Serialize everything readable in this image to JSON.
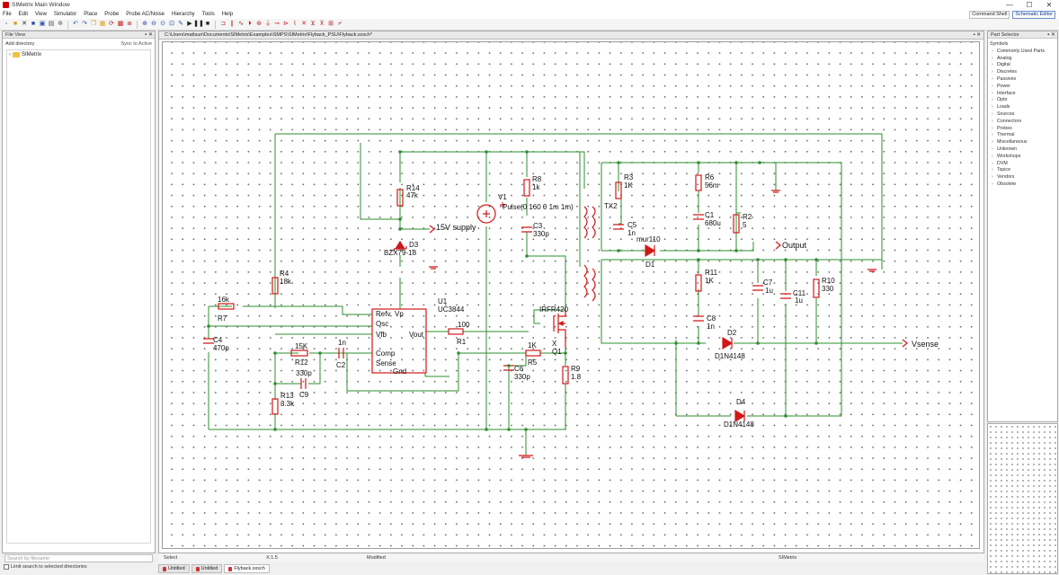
{
  "window": {
    "title": "SIMetrix Main Window",
    "controls": [
      "—",
      "☐",
      "✕"
    ]
  },
  "menu": {
    "items": [
      "File",
      "Edit",
      "View",
      "Simulator",
      "Place",
      "Probe",
      "Probe AC/Noise",
      "Hierarchy",
      "Tools",
      "Help"
    ],
    "right_buttons": [
      "Command Shell",
      "Schematic Editor"
    ]
  },
  "toolbar": {
    "buttons": [
      "new-icon",
      "open-icon",
      "cut-icon",
      "save-icon",
      "save-all-icon",
      "print-icon",
      "settings-icon",
      "undo-icon",
      "redo-icon",
      "copy-icon",
      "paste-icon",
      "rotate-icon",
      "delete-icon",
      "net-icon",
      "zoom-in-icon",
      "zoom-out-icon",
      "zoom-full-icon",
      "zoom-box-icon",
      "pencil-icon",
      "run-icon",
      "pause-icon",
      "abort-icon",
      "resistor-icon",
      "capacitor-icon",
      "inductor-icon",
      "diode-icon",
      "source-icon",
      "ground-icon",
      "probe-icon",
      "terminal-icon",
      "wire-icon",
      "cross-probe-icon",
      "check-icon",
      "edit-icon",
      "tools-icon",
      "text-icon"
    ]
  },
  "file_view": {
    "title": "File View",
    "add_directory": "Add directory",
    "sync": "Sync to Active",
    "tree_item": "SIMetrix",
    "search_placeholder": "Search by filename",
    "limit_search": "Limit search to selected directories"
  },
  "schematic": {
    "path": "C:\\Users\\mattsun\\Documents\\SIMetrix\\Examples\\SMPS\\SIMetrix\\Flyback_PSU\\Flyback.sxsch*",
    "components": {
      "R14": "R14",
      "R14v": "47k",
      "V1": "V1",
      "V1v": "Pulse(0 160 0 1m 1m)",
      "R8": "R8",
      "R8v": "1k",
      "C3": "C3",
      "C3v": "330p",
      "TX2": "TX2",
      "R3": "R3",
      "R3v": "1K",
      "R6": "R6",
      "R6v": "56m",
      "C1": "C1",
      "C1v": "680u",
      "R2": "R2",
      "R2v": "5",
      "C5": "C5",
      "C5v": "1n",
      "D1": "D1",
      "D1v": "mur110",
      "D3": "D3",
      "D3v": "BZX79-18",
      "supply": "15V supply",
      "Output": "Output",
      "R4": "R4",
      "R4v": "18k",
      "R7": "R7",
      "R7v": "16k",
      "U1": "U1",
      "U1v": "UC3844",
      "C4": "C4",
      "C4v": "470p",
      "R12": "R12",
      "R12v": "15K",
      "C2": "C2",
      "C2v": "1n",
      "C9": "C9",
      "C9v": "330p",
      "R13": "R13",
      "R13v": "3.3k",
      "R1": "R1",
      "R1v": "100",
      "Q1": "Q1",
      "Q1v": "IRFR420",
      "R5": "R5",
      "R5v": "1K",
      "C6": "C6",
      "C6v": "330p",
      "R9": "R9",
      "R9v": "1.8",
      "R11": "R11",
      "R11v": "1K",
      "C8": "C8",
      "C8v": "1n",
      "C7": "C7",
      "C7v": "1u",
      "C11": "C11",
      "C11v": "1u",
      "R10": "R10",
      "R10v": "330",
      "D2": "D2",
      "D2v": "D1N4148",
      "D4": "D4",
      "D4v": "D1N4148",
      "Vsense": "Vsense",
      "pin_Refv": "Refv",
      "pin_Vp": "Vp",
      "pin_Osc": "Osc",
      "pin_Vfb": "Vfb",
      "pin_Vout": "Vout",
      "pin_Comp": "Comp",
      "pin_Sense": "Sense",
      "pin_Gnd": "Gnd",
      "pin_X": "X"
    }
  },
  "statusbar": {
    "mode": "Select",
    "zoom": "X:1.5",
    "modified": "Modified",
    "app": "SIMetrix"
  },
  "doc_tabs": [
    "Untitled",
    "Untitled",
    "Flyback.sxsch"
  ],
  "part_selector": {
    "title": "Part Selector",
    "heading": "Symbols",
    "categories": [
      "Commonly Used Parts",
      "Analog",
      "Digital",
      "Discretes",
      "Passives",
      "Power",
      "Interface",
      "Opto",
      "Loads",
      "Sources",
      "Connectors",
      "Probes",
      "Thermal",
      "Miscellaneous",
      "Unknown",
      "Workshops",
      "DVM",
      "Tspice",
      "Vendors",
      "Obsolete"
    ]
  },
  "colors": {
    "wire": "#2e8f2e",
    "component": "#d01818",
    "label": "#111111",
    "grid_dot": "#6e6e6e"
  }
}
